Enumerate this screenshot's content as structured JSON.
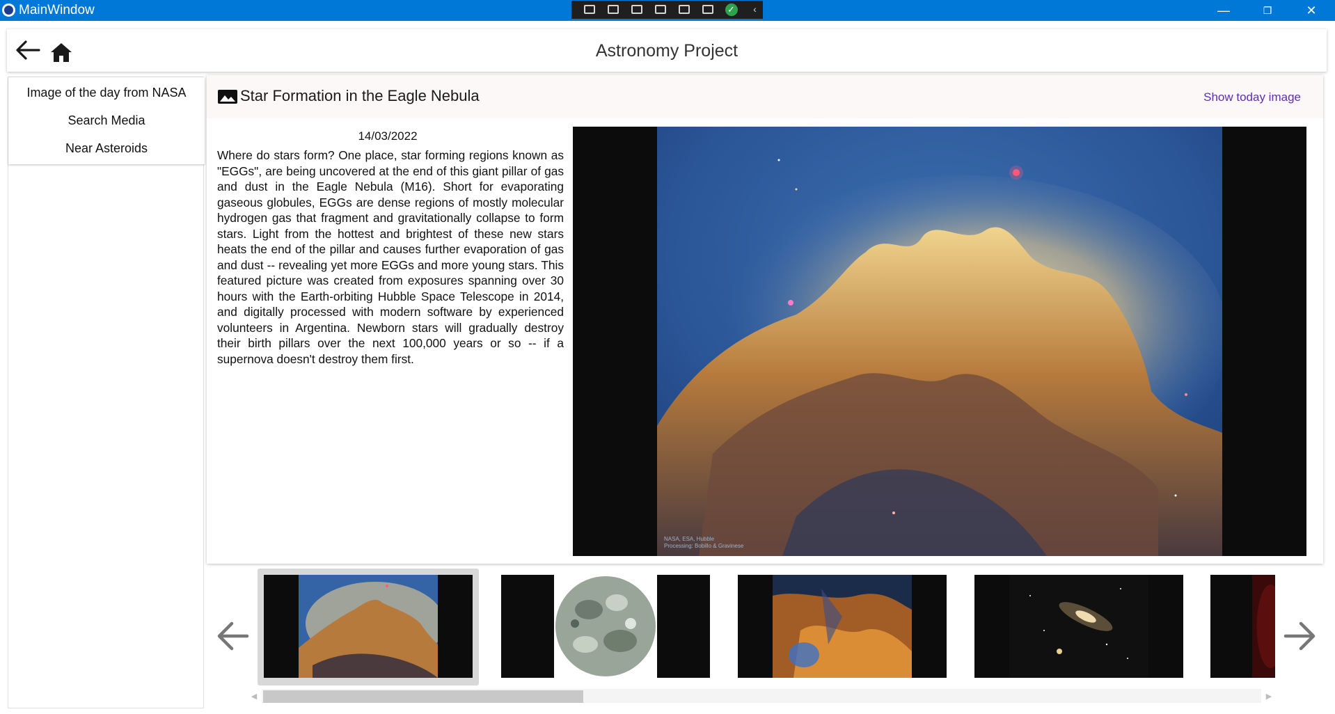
{
  "window": {
    "title": "MainWindow",
    "controls": {
      "minimize": "—",
      "restore": "❐",
      "close": "✕"
    },
    "accent": "#0078d7"
  },
  "debug_toolbar": {
    "buttons": [
      "select-element-icon",
      "video-icon",
      "pointer-icon",
      "layout-icon",
      "track-focus-icon",
      "hot-reload-icon",
      "check-icon",
      "collapse-icon"
    ]
  },
  "header": {
    "title": "Astronomy Project",
    "back_icon": "arrow-left-icon",
    "home_icon": "home-icon"
  },
  "sidebar": {
    "items": [
      {
        "label": "Image of the day from NASA"
      },
      {
        "label": "Search Media"
      },
      {
        "label": "Near Asteroids"
      }
    ]
  },
  "apod": {
    "title": "Star Formation in the Eagle Nebula",
    "show_today_label": "Show today image",
    "date": "14/03/2022",
    "explanation": "Where do stars form?  One place, star forming regions known as \"EGGs\", are being uncovered at the end of this giant pillar of gas and dust in the Eagle Nebula (M16).  Short for evaporating gaseous globules, EGGs are dense regions of mostly molecular hydrogen gas that fragment and gravitationally collapse to form stars.  Light from the hottest and brightest of these new stars heats the end of the pillar and causes further evaporation of gas and dust -- revealing yet more EGGs and more young stars.  This featured picture was created from exposures spanning over 30 hours with the Earth-orbiting Hubble Space Telescope in 2014, and digitally processed with modern software by experienced volunteers in Argentina. Newborn stars will gradually destroy their birth pillars over the next 100,000 years or so -- if a supernova doesn't destroy them first.",
    "image_credit": "NASA, ESA, Hubble  Processing: Bobillo & Gravinese",
    "accent_link_color": "#5b2fae"
  },
  "gallery": {
    "thumbnails": [
      {
        "subject": "eagle-nebula-pillar",
        "selected": true
      },
      {
        "subject": "moon",
        "selected": false
      },
      {
        "subject": "orange-nebula",
        "selected": false
      },
      {
        "subject": "spiral-galaxy",
        "selected": false
      },
      {
        "subject": "red-nebula-partial",
        "selected": false
      }
    ],
    "prev_icon": "arrow-left-icon",
    "next_icon": "arrow-right-icon",
    "scroll_position": 0.0
  }
}
